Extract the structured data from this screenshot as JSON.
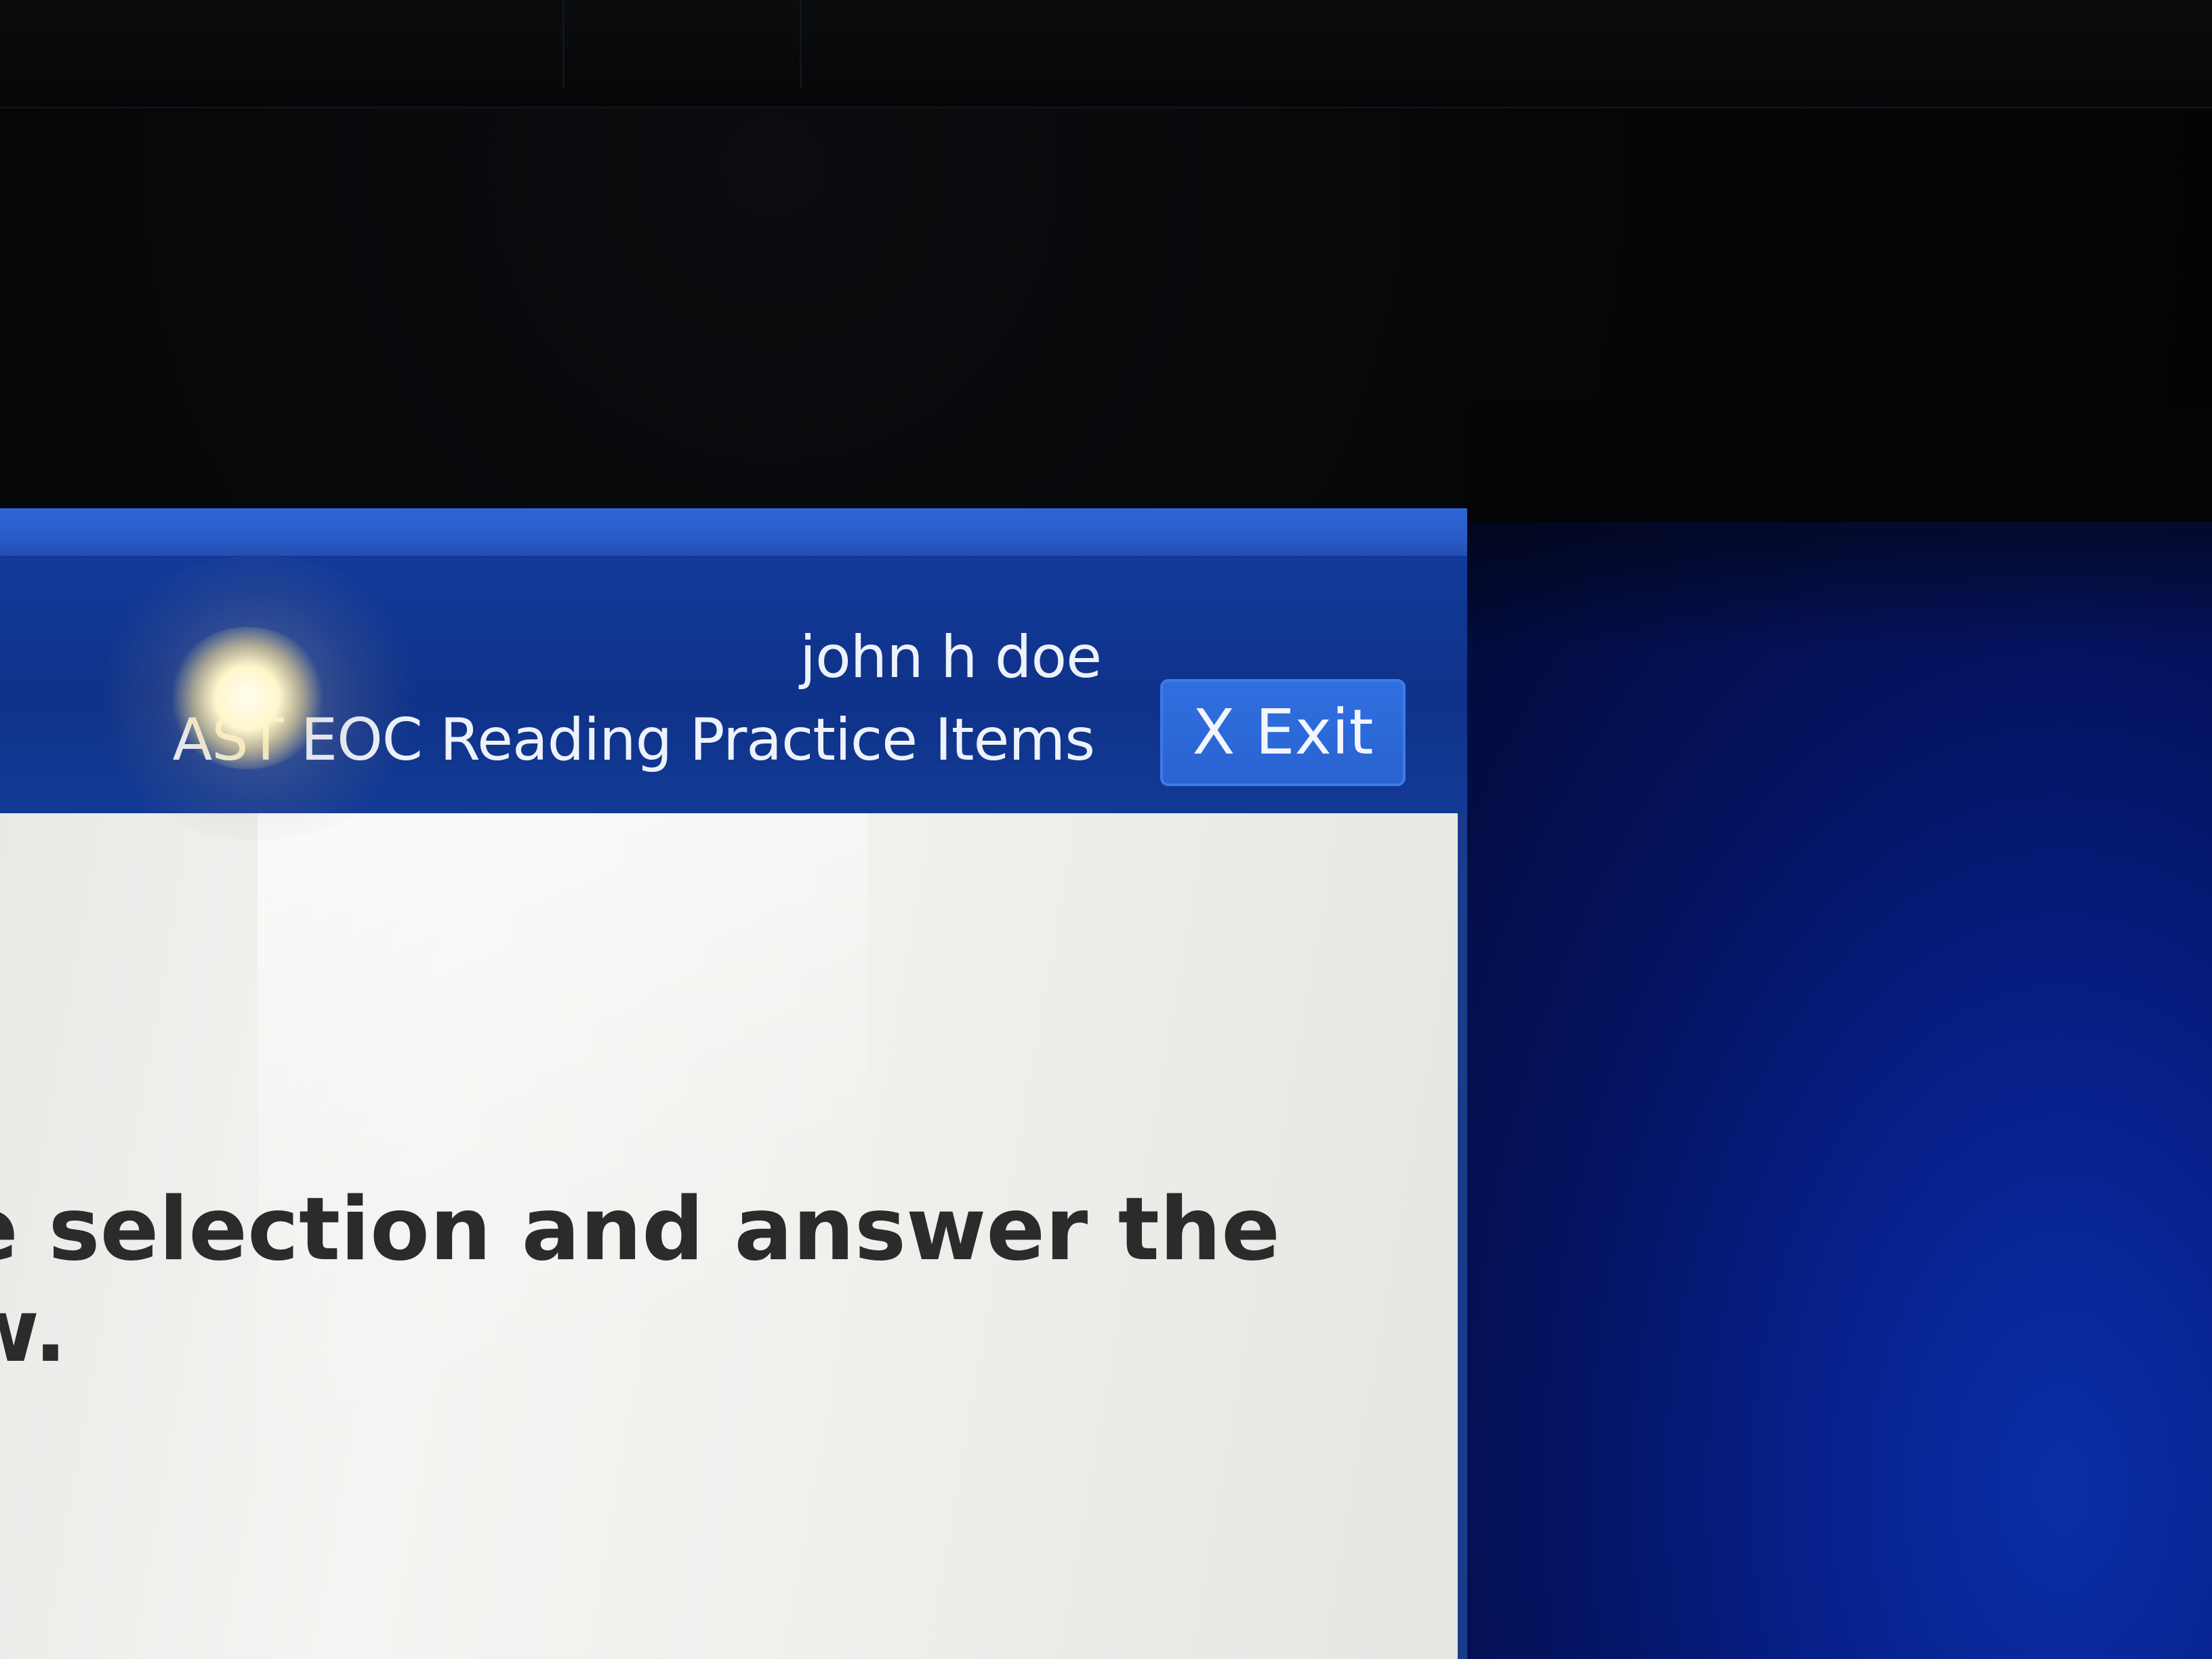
{
  "header": {
    "user_name": "john h doe",
    "test_title": "AST EOC Reading Practice Items",
    "exit_button": {
      "icon": "close-icon",
      "label": "Exit",
      "icon_glyph": "X"
    }
  },
  "content": {
    "instruction_lines": [
      "e selection and answer the",
      "w."
    ]
  },
  "colors": {
    "header_blue": "#0f3289",
    "accent_blue": "#2a5cc8",
    "exit_button_blue": "#2a63d1",
    "content_bg": "#f2f2f0",
    "text_dark": "#2b2b2b"
  }
}
